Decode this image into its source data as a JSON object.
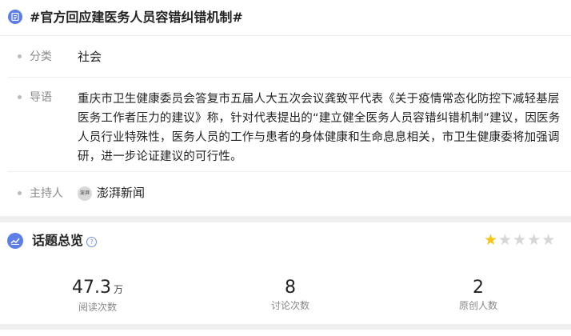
{
  "topic": {
    "title": "#官方回应建医务人员容错纠错机制#"
  },
  "category": {
    "label": "分类",
    "value": "社会"
  },
  "lead": {
    "label": "导语",
    "text": "重庆市卫生健康委员会答复市五届人大五次会议龚致平代表《关于疫情常态化防控下减轻基层医务工作者压力的建议》称，针对代表提出的“建立健全医务人员容错纠错机制”建议，因医务人员行业特殊性，医务人员的工作与患者的身体健康和生命息息相关，市卫生健康委将加强调研，进一步论证建议的可行性。"
  },
  "host": {
    "label": "主持人",
    "name": "澎湃新闻",
    "avatar_text": "澎湃"
  },
  "overview": {
    "title": "话题总览",
    "help_icon": "question-icon",
    "rating": {
      "value": 1,
      "max": 5,
      "active_color": "#f5c518",
      "inactive_color": "#d6d6d6"
    },
    "stats": [
      {
        "value": "47.3",
        "unit": "万",
        "label": "阅读次数"
      },
      {
        "value": "8",
        "unit": "",
        "label": "讨论次数"
      },
      {
        "value": "2",
        "unit": "",
        "label": "原创人数"
      }
    ]
  },
  "colors": {
    "accent": "#5d7ee6"
  }
}
